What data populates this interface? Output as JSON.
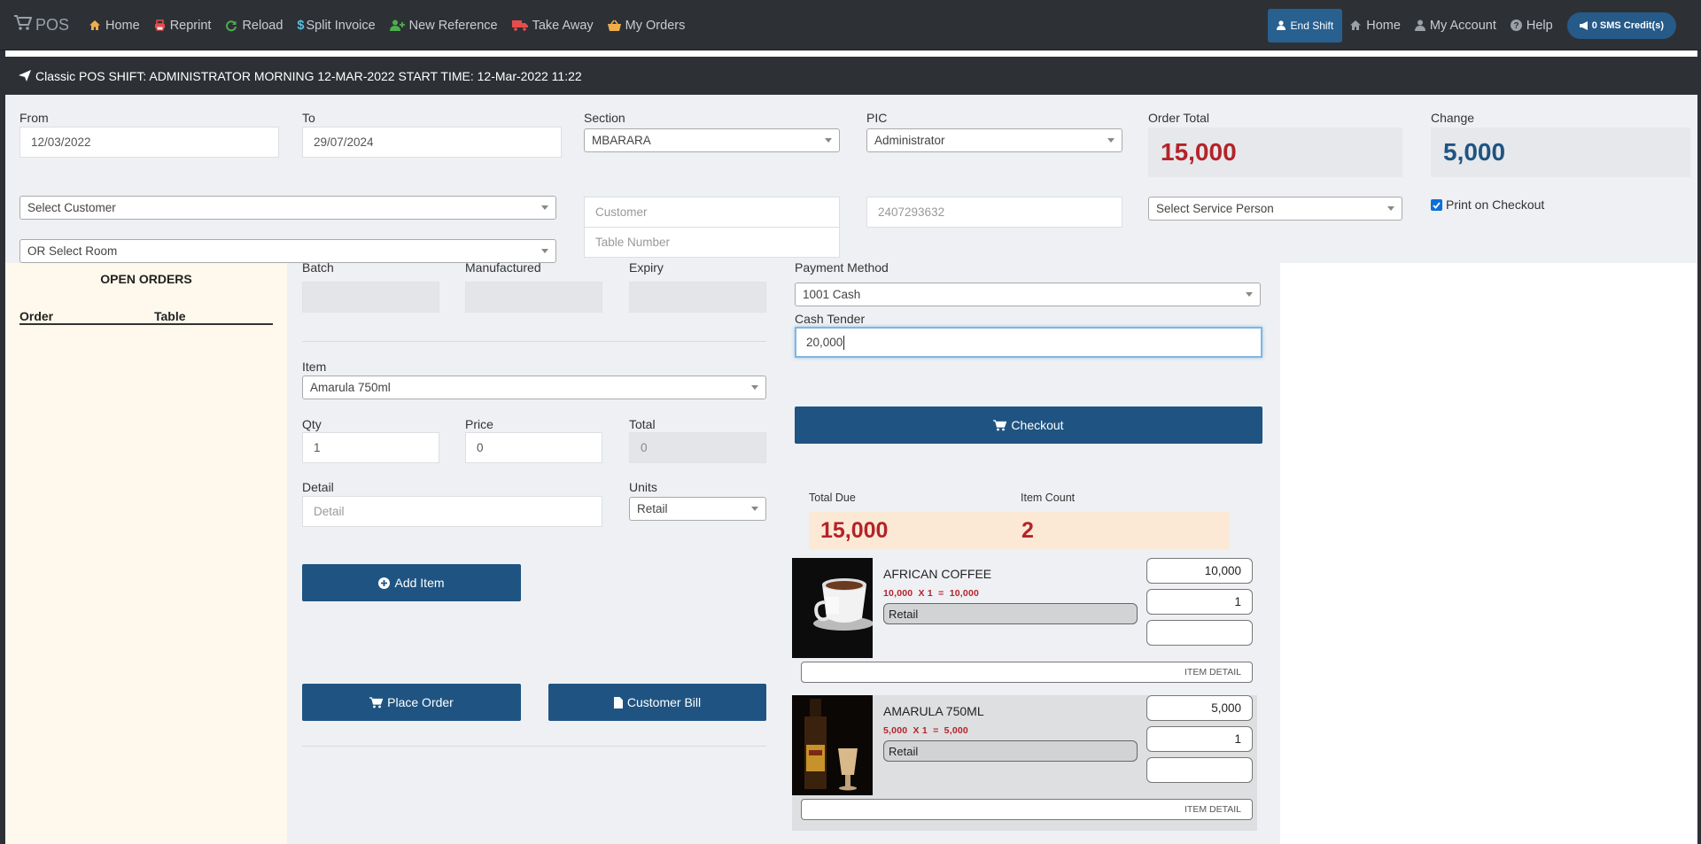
{
  "navbar": {
    "brand": "POS",
    "items": [
      {
        "label": "Home",
        "icon": "home-icon",
        "color": "#f0ad4e"
      },
      {
        "label": "Reprint",
        "icon": "print-icon",
        "color": "#e74c4c"
      },
      {
        "label": "Reload",
        "icon": "refresh-icon",
        "color": "#4cae4c"
      },
      {
        "label": "Split Invoice",
        "icon": "dollar-icon",
        "color": "#5bc0de"
      },
      {
        "label": "New Reference",
        "icon": "user-plus-icon",
        "color": "#4cae4c"
      },
      {
        "label": "Take Away",
        "icon": "truck-icon",
        "color": "#e74c4c"
      },
      {
        "label": "My Orders",
        "icon": "basket-icon",
        "color": "#f0ad4e"
      }
    ],
    "end_shift": "End Shift",
    "right_items": [
      {
        "label": "Home",
        "icon": "home-icon"
      },
      {
        "label": "My Account",
        "icon": "user-icon"
      },
      {
        "label": "Help",
        "icon": "question-icon"
      }
    ],
    "sms": "0 SMS Credit(s)"
  },
  "shift_bar": "Classic POS SHIFT: ADMINISTRATOR MORNING 12-MAR-2022 START TIME: 12-Mar-2022 11:22",
  "header": {
    "from_label": "From",
    "from_value": "12/03/2022",
    "to_label": "To",
    "to_value": "29/07/2024",
    "section_label": "Section",
    "section_value": "MBARARA",
    "pic_label": "PIC",
    "pic_value": "Administrator",
    "order_total_label": "Order Total",
    "order_total_value": "15,000",
    "change_label": "Change",
    "change_value": "5,000",
    "select_customer": "Select Customer",
    "customer_placeholder": "Customer",
    "phone_value": "2407293632",
    "service_person": "Select Service Person",
    "print_on_checkout": "Print on Checkout",
    "print_on_checkout_checked": true,
    "select_room": "OR Select Room",
    "table_placeholder": "Table Number"
  },
  "open_orders": {
    "title": "OPEN ORDERS",
    "columns": [
      "Order",
      "Table"
    ],
    "rows": []
  },
  "item_form": {
    "batch_label": "Batch",
    "manufactured_label": "Manufactured",
    "expiry_label": "Expiry",
    "item_label": "Item",
    "item_value": "Amarula 750ml",
    "qty_label": "Qty",
    "qty_value": "1",
    "price_label": "Price",
    "price_value": "0",
    "total_label": "Total",
    "total_value": "0",
    "detail_label": "Detail",
    "detail_placeholder": "Detail",
    "units_label": "Units",
    "units_value": "Retail",
    "add_item": "Add Item",
    "place_order": "Place Order",
    "customer_bill": "Customer Bill"
  },
  "payment": {
    "method_label": "Payment Method",
    "method_value": "1001 Cash",
    "cash_label": "Cash Tender",
    "cash_value": "20,000",
    "checkout": "Checkout",
    "total_due_label": "Total Due",
    "total_due_value": "15,000",
    "item_count_label": "Item Count",
    "item_count_value": "2"
  },
  "cart": [
    {
      "name": "AFRICAN COFFEE",
      "calc": "10,000  X 1  =  10,000",
      "unit": "Retail",
      "price": "10,000",
      "qty": "1",
      "extra": "",
      "detail": "ITEM DETAIL",
      "image": "coffee-cup-image"
    },
    {
      "name": "AMARULA 750ML",
      "calc": "5,000  X 1  =  5,000",
      "unit": "Retail",
      "price": "5,000",
      "qty": "1",
      "extra": "",
      "detail": "ITEM DETAIL",
      "image": "amarula-bottle-image"
    }
  ]
}
